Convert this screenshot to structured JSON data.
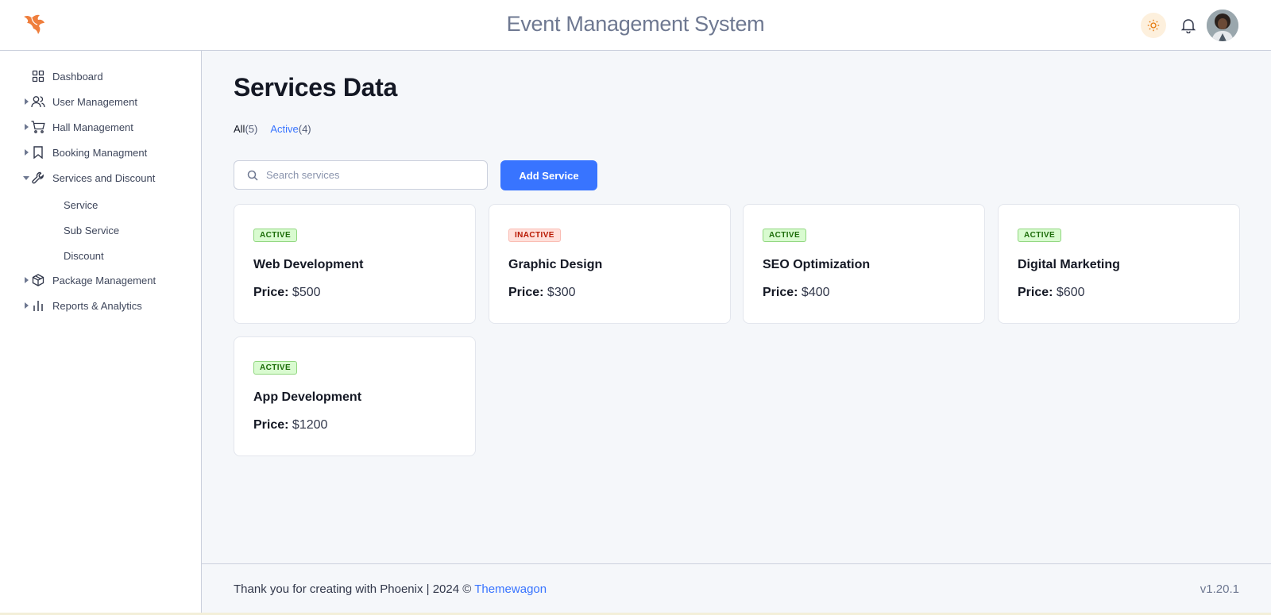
{
  "header": {
    "title": "Event Management System",
    "logo_icon": "phoenix-logo",
    "accent": "#ef7e3c"
  },
  "sidebar": {
    "items": [
      {
        "label": "Dashboard",
        "icon": "grid-icon",
        "has_caret": false
      },
      {
        "label": "User Management",
        "icon": "users-icon",
        "has_caret": true
      },
      {
        "label": "Hall Management",
        "icon": "cart-icon",
        "has_caret": true
      },
      {
        "label": "Booking Managment",
        "icon": "bookmark-icon",
        "has_caret": true
      },
      {
        "label": "Services and Discount",
        "icon": "wrench-icon",
        "has_caret": true,
        "expanded": true
      },
      {
        "label": "Package Management",
        "icon": "package-icon",
        "has_caret": true
      },
      {
        "label": "Reports & Analytics",
        "icon": "bar-chart-icon",
        "has_caret": true
      }
    ],
    "sub_items": [
      "Service",
      "Sub Service",
      "Discount"
    ]
  },
  "main": {
    "title": "Services Data",
    "tabs": [
      {
        "label": "All",
        "count": "(5)"
      },
      {
        "label": "Active",
        "count": "(4)"
      }
    ],
    "search": {
      "placeholder": "Search services"
    },
    "add_button": "Add Service",
    "price_label": "Price:",
    "services": [
      {
        "status": "ACTIVE",
        "name": "Web Development",
        "price": "$500"
      },
      {
        "status": "INACTIVE",
        "name": "Graphic Design",
        "price": "$300"
      },
      {
        "status": "ACTIVE",
        "name": "SEO Optimization",
        "price": "$400"
      },
      {
        "status": "ACTIVE",
        "name": "Digital Marketing",
        "price": "$600"
      },
      {
        "status": "ACTIVE",
        "name": "App Development",
        "price": "$1200"
      }
    ]
  },
  "footer": {
    "text": "Thank you for creating with Phoenix | 2024 ©",
    "link": "Themewagon",
    "version": "v1.20.1"
  },
  "colors": {
    "primary": "#3874ff",
    "active_badge_bg": "#d9fbd0",
    "inactive_badge_bg": "#ffe0db"
  }
}
